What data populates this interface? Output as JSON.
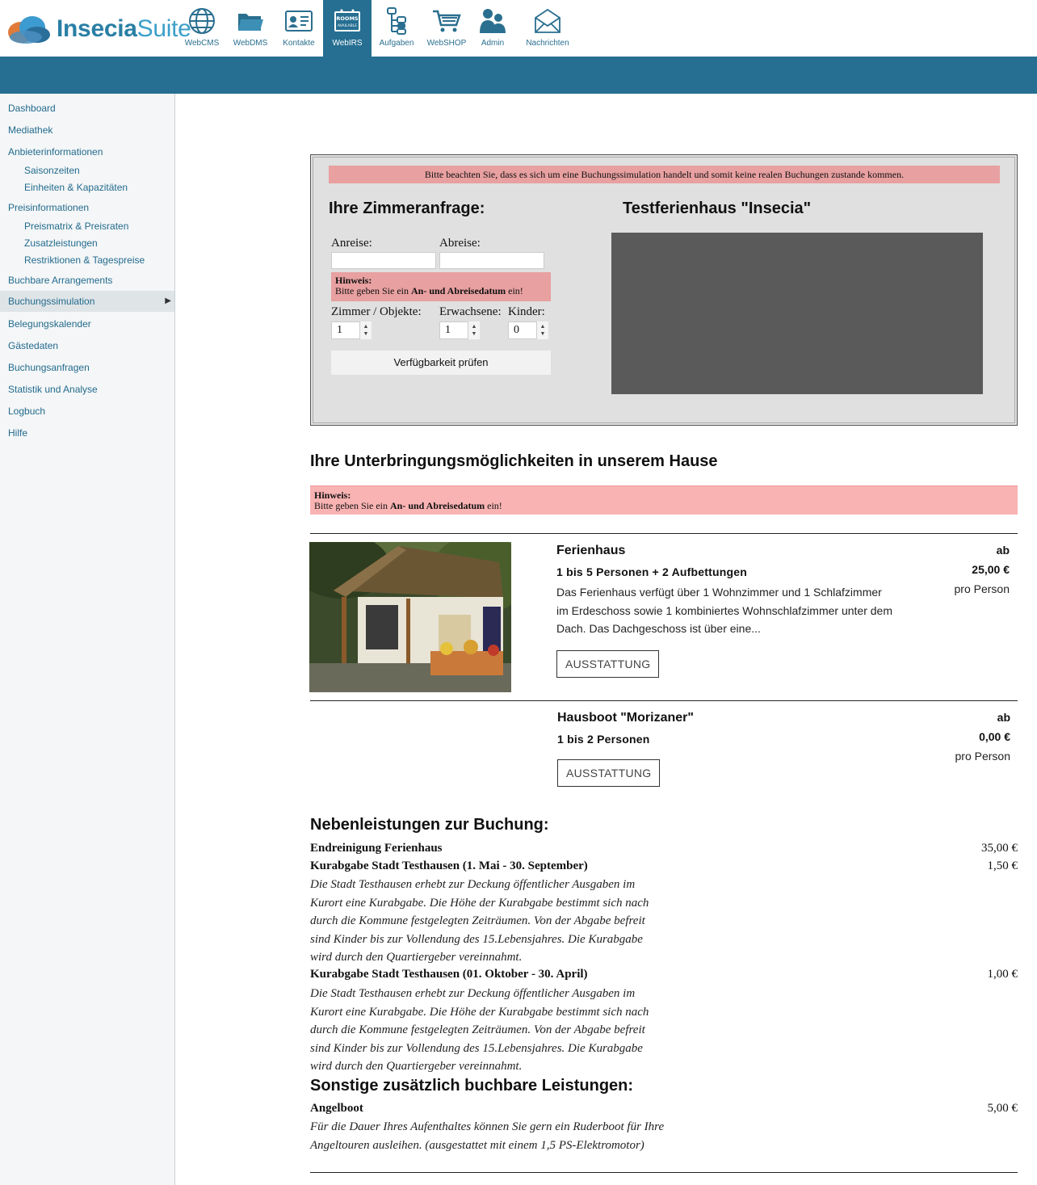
{
  "brand": {
    "name_bold": "Insecia",
    "name_light": "Suite"
  },
  "nav": [
    {
      "label": "WebCMS",
      "icon": "globe-icon"
    },
    {
      "label": "WebDMS",
      "icon": "folder-icon"
    },
    {
      "label": "Kontakte",
      "icon": "contact-card-icon"
    },
    {
      "label": "WebIRS",
      "icon": "rooms-available-icon",
      "icon_text1": "ROOMS",
      "icon_text2": "AVAILABLE",
      "active": true
    },
    {
      "label": "Aufgaben",
      "icon": "task-tree-icon"
    },
    {
      "label": "WebSHOP",
      "icon": "cart-icon"
    },
    {
      "label": "Admin",
      "icon": "users-icon"
    },
    {
      "label": "Nachrichten",
      "icon": "mail-icon"
    }
  ],
  "sidebar": {
    "items": [
      {
        "label": "Dashboard"
      },
      {
        "label": "Mediathek"
      },
      {
        "label": "Anbieterinformationen"
      },
      {
        "label": "Saisonzeiten"
      },
      {
        "label": "Einheiten & Kapazitäten"
      },
      {
        "label": "Preisinformationen"
      },
      {
        "label": "Preismatrix & Preisraten"
      },
      {
        "label": "Zusatzleistungen"
      },
      {
        "label": "Restriktionen & Tagespreise"
      },
      {
        "label": "Buchbare Arrangements"
      },
      {
        "label": "Buchungssimulation"
      },
      {
        "label": "Belegungskalender"
      },
      {
        "label": "Gästedaten"
      },
      {
        "label": "Buchungsanfragen"
      },
      {
        "label": "Statistik und Analyse"
      },
      {
        "label": "Logbuch"
      },
      {
        "label": "Hilfe"
      }
    ],
    "active_arrow": "▶"
  },
  "simulation": {
    "warning": "Bitte beachten Sie, dass es sich um eine Buchungssimulation handelt und somit keine realen Buchungen zustande kommen.",
    "request_title": "Ihre Zimmeranfrage:",
    "house_title": "Testferienhaus \"Insecia\"",
    "arrival_label": "Anreise:",
    "departure_label": "Abreise:",
    "arrival_value": "",
    "departure_value": "",
    "hint_title": "Hinweis:",
    "hint_pre": "Bitte geben Sie ein ",
    "hint_bold": "An- und Abreisedatum",
    "hint_post": " ein!",
    "rooms_label": "Zimmer / Objekte:",
    "adults_label": "Erwachsene:",
    "children_label": "Kinder:",
    "rooms_value": "1",
    "adults_value": "1",
    "children_value": "0",
    "check_button": "Verfügbarkeit prüfen"
  },
  "accommodations": {
    "title": "Ihre Unterbringungsmöglichkeiten in unserem Hause",
    "hint_title": "Hinweis:",
    "hint_pre": "Bitte geben Sie ein ",
    "hint_bold": "An- und Abreisedatum",
    "hint_post": " ein!",
    "items": [
      {
        "name": "Ferienhaus",
        "capacity": "1 bis 5 Personen + 2 Aufbettungen",
        "description": "Das Ferienhaus verfügt über 1 Wohnzimmer und 1 Schlafzimmer im Erdeschoss sowie 1 kombiniertes Wohnschlafzimmer unter dem Dach. Das Dachgeschoss ist über eine...",
        "button": "AUSSTATTUNG",
        "price_prefix": "ab",
        "price": "25,00 €",
        "price_unit": "pro Person"
      },
      {
        "name": "Hausboot \"Morizaner\"",
        "capacity": "1 bis 2 Personen",
        "button": "AUSSTATTUNG",
        "price_prefix": "ab",
        "price": "0,00 €",
        "price_unit": "pro Person"
      }
    ]
  },
  "extras": {
    "title": "Nebenleistungen zur Buchung:",
    "items": [
      {
        "name": "Endreinigung Ferienhaus",
        "price": "35,00 €"
      },
      {
        "name": "Kurabgabe Stadt Testhausen (1. Mai - 30. September)",
        "price": "1,50 €",
        "description": "Die Stadt Testhausen erhebt zur Deckung öffentlicher Ausgaben im Kurort eine Kurabgabe. Die Höhe der Kurabgabe bestimmt sich nach durch die Kommune festgelegten Zeiträumen. Von der Abgabe befreit sind Kinder bis zur Vollendung des 15.Lebensjahres. Die Kurabgabe wird durch den Quartiergeber vereinnahmt."
      },
      {
        "name": "Kurabgabe Stadt Testhausen (01. Oktober - 30. April)",
        "price": "1,00 €",
        "description": "Die Stadt Testhausen erhebt zur Deckung öffentlicher Ausgaben im Kurort eine Kurabgabe. Die Höhe der Kurabgabe bestimmt sich nach durch die Kommune festgelegten Zeiträumen. Von der Abgabe befreit sind Kinder bis zur Vollendung des 15.Lebensjahres. Die Kurabgabe wird durch den Quartiergeber vereinnahmt."
      }
    ]
  },
  "other": {
    "title": "Sonstige zusätzlich buchbare Leistungen:",
    "items": [
      {
        "name": "Angelboot",
        "price": "5,00 €",
        "description": "Für die Dauer Ihres Aufenthaltes können Sie gern ein Ruderboot für Ihre Angeltouren ausleihen. (ausgestattet mit einem 1,5 PS-Elektromotor)"
      }
    ]
  }
}
